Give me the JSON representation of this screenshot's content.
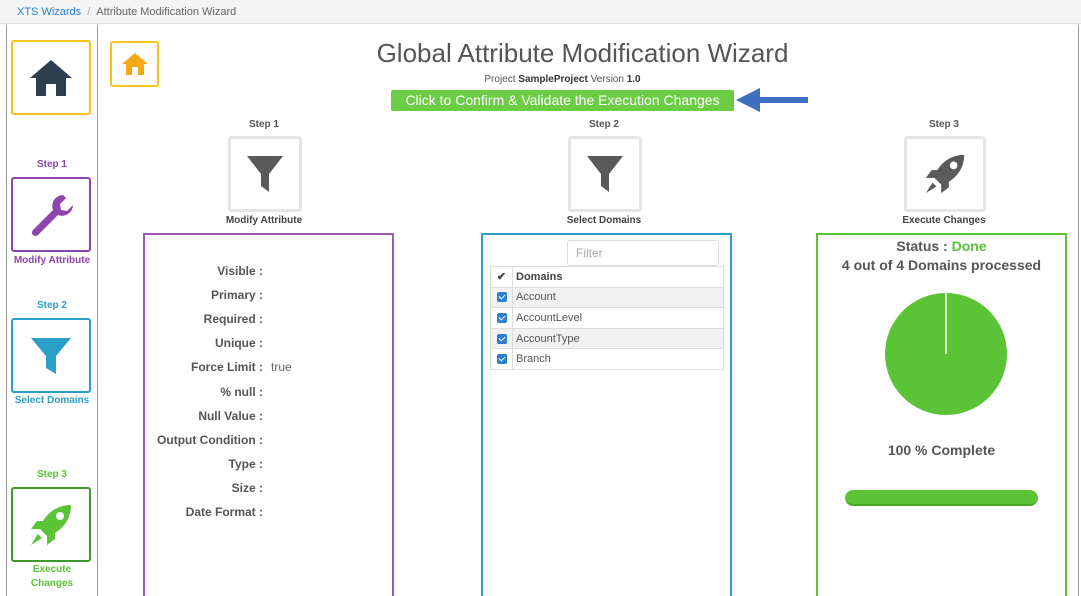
{
  "breadcrumb": {
    "root": "XTS Wizards",
    "separator": "/",
    "current": "Attribute Modification Wizard"
  },
  "sidebar": {
    "home_icon": "home-icon",
    "steps": [
      {
        "step": "Step 1",
        "label": "Modify Attribute",
        "icon": "wrench-icon",
        "color": "#8e44ad"
      },
      {
        "step": "Step 2",
        "label": "Select Domains",
        "icon": "filter-icon",
        "color": "#2aa0c8"
      },
      {
        "step": "Step 3",
        "label_line1": "Execute",
        "label_line2": "Changes",
        "icon": "rocket-icon",
        "color": "#5ac436"
      }
    ]
  },
  "header": {
    "title": "Global Attribute Modification Wizard",
    "project_prefix": "Project",
    "project_name": "SampleProject",
    "version_prefix": "Version",
    "version": "1.0",
    "confirm_label": "Click to Confirm & Validate the Execution Changes"
  },
  "steps": [
    {
      "step": "Step 1",
      "name": "Modify Attribute",
      "icon": "filter-icon"
    },
    {
      "step": "Step 2",
      "name": "Select Domains",
      "icon": "filter-icon"
    },
    {
      "step": "Step 3",
      "name": "Execute Changes",
      "icon": "rocket-icon"
    }
  ],
  "attributes": [
    {
      "label": "Visible :",
      "value": ""
    },
    {
      "label": "Primary :",
      "value": ""
    },
    {
      "label": "Required :",
      "value": ""
    },
    {
      "label": "Unique :",
      "value": ""
    },
    {
      "label": "Force Limit :",
      "value": "true"
    },
    {
      "label": "% null :",
      "value": ""
    },
    {
      "label": "Null Value :",
      "value": ""
    },
    {
      "label": "Output Condition :",
      "value": ""
    },
    {
      "label": "Type :",
      "value": ""
    },
    {
      "label": "Size :",
      "value": ""
    },
    {
      "label": "Date Format :",
      "value": ""
    }
  ],
  "domains": {
    "filter_placeholder": "Filter",
    "header": "Domains",
    "rows": [
      {
        "name": "Account",
        "checked": true
      },
      {
        "name": "AccountLevel",
        "checked": true
      },
      {
        "name": "AccountType",
        "checked": true
      },
      {
        "name": "Branch",
        "checked": true
      }
    ]
  },
  "execution": {
    "status_label": "Status :",
    "status_value": "Done",
    "processed_text": "4 out of 4 Domains processed",
    "complete_text": "100 % Complete",
    "progress": 1.0
  },
  "colors": {
    "accent_green": "#5ac436",
    "home_yellow": "#f5c518",
    "purple": "#8e44ad",
    "teal": "#2aa0c8",
    "arrow_blue": "#3f6fc0"
  }
}
